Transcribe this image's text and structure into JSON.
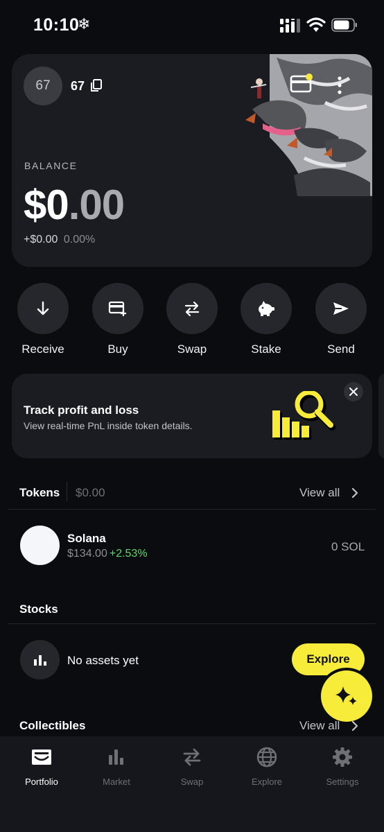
{
  "status_bar": {
    "time": "10:10",
    "weather_icon": "snowflake-icon"
  },
  "account": {
    "avatar_text": "67",
    "name": "67"
  },
  "balance": {
    "label": "BALANCE",
    "whole": "$0",
    "decimal": ".00",
    "change_amount": "+$0.00",
    "change_pct": "0.00%"
  },
  "actions": [
    {
      "label": "Receive",
      "icon": "arrow-down-icon"
    },
    {
      "label": "Buy",
      "icon": "card-plus-icon"
    },
    {
      "label": "Swap",
      "icon": "swap-arrows-icon"
    },
    {
      "label": "Stake",
      "icon": "piggy-bank-icon"
    },
    {
      "label": "Send",
      "icon": "send-icon"
    }
  ],
  "promo": {
    "title": "Track profit and loss",
    "subtitle": "View real-time PnL inside token details."
  },
  "tokens": {
    "title": "Tokens",
    "total": "$0.00",
    "view_all": "View all",
    "items": [
      {
        "name": "Solana",
        "price": "$134.00",
        "change": "+2.53%",
        "balance": "0 SOL"
      }
    ]
  },
  "stocks": {
    "title": "Stocks",
    "empty_text": "No assets yet",
    "explore_label": "Explore"
  },
  "collectibles": {
    "title": "Collectibles",
    "view_all": "View all"
  },
  "nav": [
    {
      "label": "Portfolio",
      "icon": "wallet-icon",
      "active": true
    },
    {
      "label": "Market",
      "icon": "bar-chart-icon",
      "active": false
    },
    {
      "label": "Swap",
      "icon": "swap-arrows-icon",
      "active": false
    },
    {
      "label": "Explore",
      "icon": "globe-icon",
      "active": false
    },
    {
      "label": "Settings",
      "icon": "gear-icon",
      "active": false
    }
  ],
  "colors": {
    "background": "#0b0c10",
    "card": "#1b1c21",
    "accent_yellow": "#f8ec3a",
    "positive_green": "#5bd86b"
  }
}
